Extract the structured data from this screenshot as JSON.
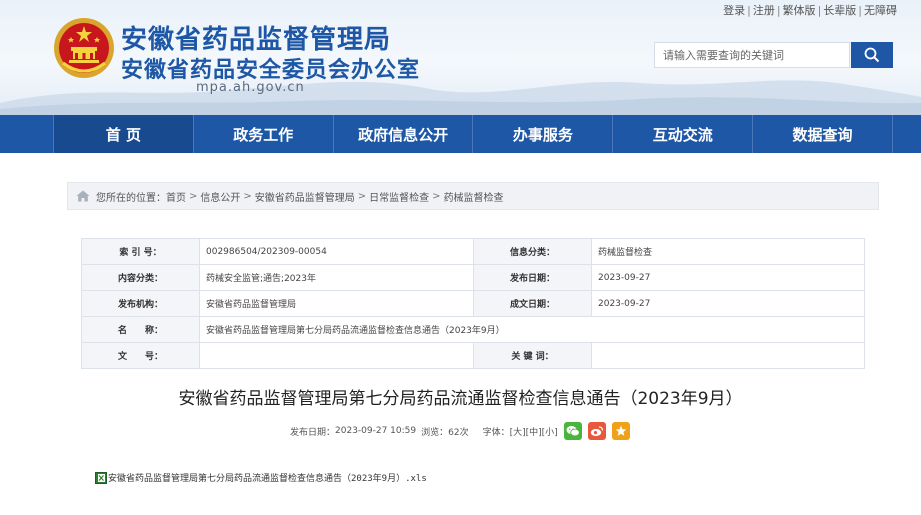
{
  "header": {
    "title1": "安徽省药品监督管理局",
    "title2": "安徽省药品安全委员会办公室",
    "domain": "mpa.ah.gov.cn",
    "top_links": [
      "登录",
      "注册",
      "繁体版",
      "长辈版",
      "无障碍"
    ],
    "search_placeholder": "请输入需要查询的关键词"
  },
  "nav": {
    "items": [
      "首 页",
      "政务工作",
      "政府信息公开",
      "办事服务",
      "互动交流",
      "数据查询"
    ]
  },
  "breadcrumb": {
    "prefix": "您所在的位置：",
    "items": [
      "首页",
      "信息公开",
      "安徽省药品监督管理局",
      "日常监督检查",
      "药械监督检查"
    ]
  },
  "info": {
    "index_label": "索 引 号：",
    "index_value": "002986504/202309-00054",
    "category_label": "信息分类：",
    "category_value": "药械监督检查",
    "content_label": "内容分类：",
    "content_value": "药械安全监管;通告;2023年",
    "date_label": "发布日期：",
    "date_value": "2023-09-27",
    "org_label": "发布机构：",
    "org_value": "安徽省药品监督管理局",
    "made_label": "成文日期：",
    "made_value": "2023-09-27",
    "name_label": "名　　称：",
    "name_value": "安徽省药品监督管理局第七分局药品流通监督检查信息通告（2023年9月）",
    "docno_label": "文　　号：",
    "docno_value": "",
    "keywords_label": "关 键 词：",
    "keywords_value": ""
  },
  "article": {
    "title": "安徽省药品监督管理局第七分局药品流通监督检查信息通告（2023年9月）",
    "publish_prefix": "发布日期：",
    "publish_date": "2023-09-27 10:59",
    "views": "浏览：62次",
    "font_label": "字体：",
    "font_large": "[大]",
    "font_medium": "[中]",
    "font_small": "[小]",
    "attachment": "安徽省药品监督管理局第七分局药品流通监督检查信息通告（2023年9月）.xls"
  },
  "icons": {
    "emblem": "national-emblem-icon",
    "search": "search-icon",
    "home": "home-icon",
    "wechat": "wechat-icon",
    "weibo": "weibo-icon",
    "favorite": "favorite-icon",
    "excel": "excel-file-icon"
  },
  "colors": {
    "brand_blue": "#1d57a6",
    "wechat": "#4ab53d",
    "weibo": "#e8583b",
    "favorite": "#f0a11a"
  }
}
